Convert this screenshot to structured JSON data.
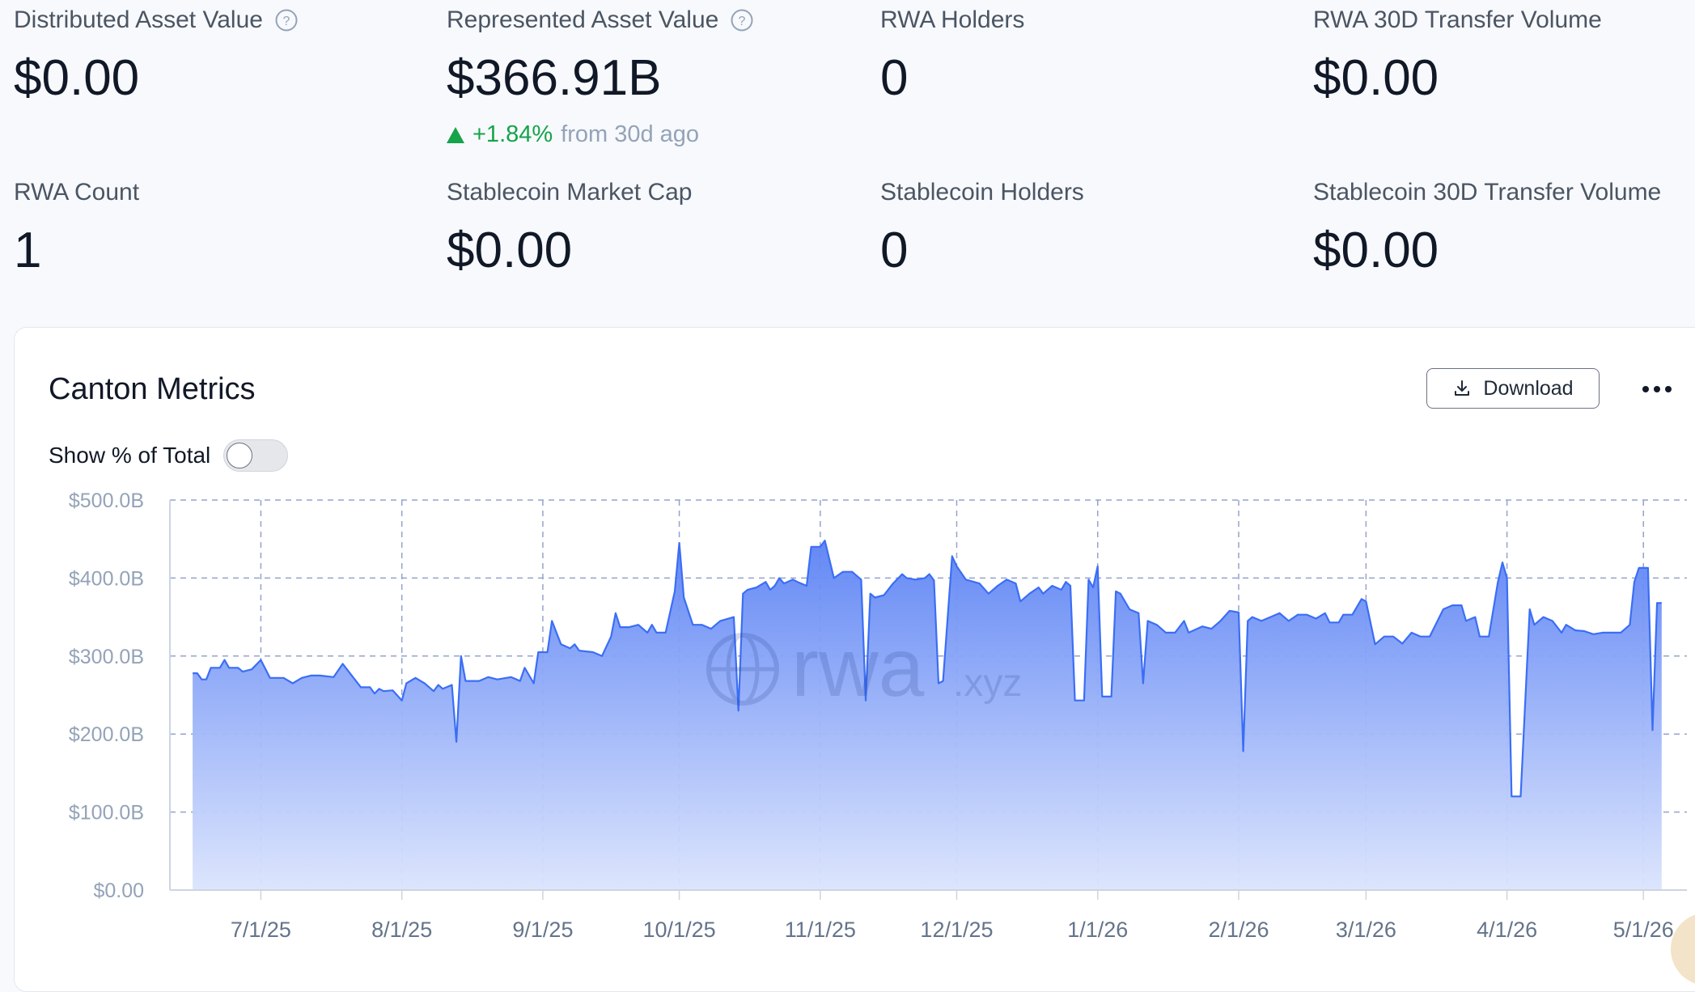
{
  "stats": [
    {
      "label": "Distributed Asset Value",
      "value": "$0.00",
      "help": true
    },
    {
      "label": "Represented Asset Value",
      "value": "$366.91B",
      "help": true,
      "change": "+1.84%",
      "change_suffix": "from 30d ago"
    },
    {
      "label": "RWA Holders",
      "value": "0",
      "help": false
    },
    {
      "label": "RWA 30D Transfer Volume",
      "value": "$0.00",
      "help": false
    },
    {
      "label": "RWA Count",
      "value": "1",
      "help": false
    },
    {
      "label": "Stablecoin Market Cap",
      "value": "$0.00",
      "help": false
    },
    {
      "label": "Stablecoin Holders",
      "value": "0",
      "help": false
    },
    {
      "label": "Stablecoin 30D Transfer Volume",
      "value": "$0.00",
      "help": false
    }
  ],
  "card": {
    "title": "Canton Metrics",
    "download_label": "Download",
    "toggle_label": "Show % of Total",
    "toggle_on": false
  },
  "colors": {
    "accent": "#3b6ef5",
    "positive": "#16a34a"
  },
  "watermark": {
    "main": "rwa",
    "suffix": ".xyz"
  },
  "chart_data": {
    "type": "area",
    "title": "Canton Metrics",
    "xlabel": "",
    "ylabel": "",
    "ylim": [
      0,
      500
    ],
    "y_ticks": [
      "$0.00",
      "$100.0B",
      "$200.0B",
      "$300.0B",
      "$400.0B",
      "$500.0B"
    ],
    "x_ticks": [
      {
        "date": "2025-07-01",
        "label": "7/1/25"
      },
      {
        "date": "2025-08-01",
        "label": "8/1/25"
      },
      {
        "date": "2025-09-01",
        "label": "9/1/25"
      },
      {
        "date": "2025-10-01",
        "label": "10/1/25"
      },
      {
        "date": "2025-11-01",
        "label": "11/1/25"
      },
      {
        "date": "2025-12-01",
        "label": "12/1/25"
      },
      {
        "date": "2026-01-01",
        "label": "1/1/26"
      },
      {
        "date": "2026-02-01",
        "label": "2/1/26"
      },
      {
        "date": "2026-03-01",
        "label": "3/1/26"
      },
      {
        "date": "2026-04-01",
        "label": "4/1/26"
      },
      {
        "date": "2026-05-01",
        "label": "5/1/26"
      }
    ],
    "grid": true,
    "series": [
      {
        "points": [
          [
            "2025-06-16",
            278
          ],
          [
            "2025-06-17",
            278
          ],
          [
            "2025-06-18",
            270
          ],
          [
            "2025-06-19",
            270
          ],
          [
            "2025-06-20",
            285
          ],
          [
            "2025-06-22",
            285
          ],
          [
            "2025-06-23",
            295
          ],
          [
            "2025-06-24",
            285
          ],
          [
            "2025-06-26",
            285
          ],
          [
            "2025-06-27",
            280
          ],
          [
            "2025-06-29",
            283
          ],
          [
            "2025-07-01",
            295
          ],
          [
            "2025-07-03",
            272
          ],
          [
            "2025-07-06",
            272
          ],
          [
            "2025-07-08",
            265
          ],
          [
            "2025-07-10",
            272
          ],
          [
            "2025-07-12",
            275
          ],
          [
            "2025-07-14",
            275
          ],
          [
            "2025-07-17",
            273
          ],
          [
            "2025-07-19",
            290
          ],
          [
            "2025-07-21",
            275
          ],
          [
            "2025-07-23",
            260
          ],
          [
            "2025-07-25",
            260
          ],
          [
            "2025-07-26",
            252
          ],
          [
            "2025-07-27",
            258
          ],
          [
            "2025-07-28",
            255
          ],
          [
            "2025-07-30",
            256
          ],
          [
            "2025-08-01",
            243
          ],
          [
            "2025-08-02",
            265
          ],
          [
            "2025-08-04",
            272
          ],
          [
            "2025-08-06",
            265
          ],
          [
            "2025-08-08",
            255
          ],
          [
            "2025-08-09",
            263
          ],
          [
            "2025-08-10",
            258
          ],
          [
            "2025-08-12",
            263
          ],
          [
            "2025-08-13",
            190
          ],
          [
            "2025-08-14",
            300
          ],
          [
            "2025-08-15",
            268
          ],
          [
            "2025-08-18",
            268
          ],
          [
            "2025-08-20",
            273
          ],
          [
            "2025-08-22",
            270
          ],
          [
            "2025-08-25",
            273
          ],
          [
            "2025-08-27",
            268
          ],
          [
            "2025-08-28",
            285
          ],
          [
            "2025-08-30",
            265
          ],
          [
            "2025-08-31",
            305
          ],
          [
            "2025-09-02",
            305
          ],
          [
            "2025-09-03",
            345
          ],
          [
            "2025-09-05",
            315
          ],
          [
            "2025-09-07",
            310
          ],
          [
            "2025-09-08",
            315
          ],
          [
            "2025-09-09",
            307
          ],
          [
            "2025-09-12",
            305
          ],
          [
            "2025-09-14",
            300
          ],
          [
            "2025-09-16",
            325
          ],
          [
            "2025-09-17",
            355
          ],
          [
            "2025-09-18",
            337
          ],
          [
            "2025-09-20",
            337
          ],
          [
            "2025-09-22",
            340
          ],
          [
            "2025-09-24",
            330
          ],
          [
            "2025-09-25",
            340
          ],
          [
            "2025-09-26",
            330
          ],
          [
            "2025-09-28",
            330
          ],
          [
            "2025-09-30",
            383
          ],
          [
            "2025-10-01",
            445
          ],
          [
            "2025-10-02",
            375
          ],
          [
            "2025-10-04",
            340
          ],
          [
            "2025-10-06",
            340
          ],
          [
            "2025-10-08",
            335
          ],
          [
            "2025-10-10",
            345
          ],
          [
            "2025-10-13",
            350
          ],
          [
            "2025-10-14",
            230
          ],
          [
            "2025-10-15",
            380
          ],
          [
            "2025-10-16",
            385
          ],
          [
            "2025-10-18",
            388
          ],
          [
            "2025-10-20",
            395
          ],
          [
            "2025-10-21",
            385
          ],
          [
            "2025-10-22",
            390
          ],
          [
            "2025-10-23",
            400
          ],
          [
            "2025-10-24",
            393
          ],
          [
            "2025-10-26",
            398
          ],
          [
            "2025-10-27",
            395
          ],
          [
            "2025-10-29",
            390
          ],
          [
            "2025-10-30",
            440
          ],
          [
            "2025-11-01",
            440
          ],
          [
            "2025-11-02",
            448
          ],
          [
            "2025-11-04",
            400
          ],
          [
            "2025-11-06",
            408
          ],
          [
            "2025-11-08",
            408
          ],
          [
            "2025-11-10",
            398
          ],
          [
            "2025-11-11",
            243
          ],
          [
            "2025-11-12",
            380
          ],
          [
            "2025-11-13",
            375
          ],
          [
            "2025-11-15",
            378
          ],
          [
            "2025-11-17",
            393
          ],
          [
            "2025-11-19",
            405
          ],
          [
            "2025-11-20",
            400
          ],
          [
            "2025-11-22",
            398
          ],
          [
            "2025-11-24",
            400
          ],
          [
            "2025-11-25",
            405
          ],
          [
            "2025-11-26",
            397
          ],
          [
            "2025-11-27",
            265
          ],
          [
            "2025-11-28",
            268
          ],
          [
            "2025-11-30",
            428
          ],
          [
            "2025-12-01",
            415
          ],
          [
            "2025-12-03",
            398
          ],
          [
            "2025-12-06",
            393
          ],
          [
            "2025-12-08",
            380
          ],
          [
            "2025-12-10",
            390
          ],
          [
            "2025-12-12",
            398
          ],
          [
            "2025-12-14",
            393
          ],
          [
            "2025-12-15",
            370
          ],
          [
            "2025-12-17",
            380
          ],
          [
            "2025-12-19",
            388
          ],
          [
            "2025-12-20",
            380
          ],
          [
            "2025-12-22",
            390
          ],
          [
            "2025-12-24",
            385
          ],
          [
            "2025-12-25",
            395
          ],
          [
            "2025-12-26",
            390
          ],
          [
            "2025-12-27",
            243
          ],
          [
            "2025-12-29",
            243
          ],
          [
            "2025-12-30",
            398
          ],
          [
            "2025-12-31",
            388
          ],
          [
            "2026-01-01",
            415
          ],
          [
            "2026-01-02",
            248
          ],
          [
            "2026-01-04",
            248
          ],
          [
            "2026-01-05",
            383
          ],
          [
            "2026-01-06",
            380
          ],
          [
            "2026-01-08",
            360
          ],
          [
            "2026-01-10",
            355
          ],
          [
            "2026-01-11",
            265
          ],
          [
            "2026-01-12",
            345
          ],
          [
            "2026-01-14",
            340
          ],
          [
            "2026-01-16",
            330
          ],
          [
            "2026-01-18",
            330
          ],
          [
            "2026-01-20",
            345
          ],
          [
            "2026-01-21",
            330
          ],
          [
            "2026-01-24",
            338
          ],
          [
            "2026-01-26",
            335
          ],
          [
            "2026-01-28",
            345
          ],
          [
            "2026-01-30",
            358
          ],
          [
            "2026-02-01",
            356
          ],
          [
            "2026-02-02",
            178
          ],
          [
            "2026-02-03",
            345
          ],
          [
            "2026-02-04",
            350
          ],
          [
            "2026-02-06",
            345
          ],
          [
            "2026-02-08",
            350
          ],
          [
            "2026-02-10",
            355
          ],
          [
            "2026-02-12",
            345
          ],
          [
            "2026-02-14",
            353
          ],
          [
            "2026-02-16",
            353
          ],
          [
            "2026-02-18",
            348
          ],
          [
            "2026-02-20",
            355
          ],
          [
            "2026-02-21",
            343
          ],
          [
            "2026-02-23",
            343
          ],
          [
            "2026-02-24",
            353
          ],
          [
            "2026-02-26",
            353
          ],
          [
            "2026-02-28",
            373
          ],
          [
            "2026-03-01",
            370
          ],
          [
            "2026-03-03",
            315
          ],
          [
            "2026-03-05",
            325
          ],
          [
            "2026-03-07",
            325
          ],
          [
            "2026-03-09",
            316
          ],
          [
            "2026-03-11",
            330
          ],
          [
            "2026-03-13",
            325
          ],
          [
            "2026-03-15",
            325
          ],
          [
            "2026-03-18",
            360
          ],
          [
            "2026-03-20",
            365
          ],
          [
            "2026-03-22",
            365
          ],
          [
            "2026-03-23",
            345
          ],
          [
            "2026-03-25",
            350
          ],
          [
            "2026-03-26",
            325
          ],
          [
            "2026-03-28",
            325
          ],
          [
            "2026-03-30",
            395
          ],
          [
            "2026-03-31",
            420
          ],
          [
            "2026-04-01",
            400
          ],
          [
            "2026-04-02",
            120
          ],
          [
            "2026-04-04",
            120
          ],
          [
            "2026-04-06",
            360
          ],
          [
            "2026-04-07",
            340
          ],
          [
            "2026-04-09",
            350
          ],
          [
            "2026-04-11",
            345
          ],
          [
            "2026-04-13",
            330
          ],
          [
            "2026-04-14",
            340
          ],
          [
            "2026-04-16",
            333
          ],
          [
            "2026-04-18",
            332
          ],
          [
            "2026-04-20",
            328
          ],
          [
            "2026-04-22",
            330
          ],
          [
            "2026-04-24",
            330
          ],
          [
            "2026-04-26",
            330
          ],
          [
            "2026-04-28",
            340
          ],
          [
            "2026-04-29",
            395
          ],
          [
            "2026-04-30",
            413
          ],
          [
            "2026-05-02",
            413
          ],
          [
            "2026-05-03",
            205
          ],
          [
            "2026-05-04",
            368
          ],
          [
            "2026-05-05",
            368
          ]
        ]
      }
    ]
  }
}
